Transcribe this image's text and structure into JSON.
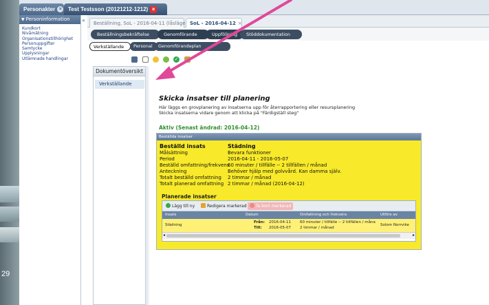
{
  "header": {
    "tabs": [
      {
        "label": "Personakter"
      },
      {
        "label": "Test Testsson (20121212-1212)"
      }
    ]
  },
  "left_strip": {
    "number": "29"
  },
  "sidebar": {
    "title": "Personinformation",
    "items": [
      {
        "label": "Kundkort"
      },
      {
        "label": "Nivåmätning"
      },
      {
        "label": "Organisationstillhörighet"
      },
      {
        "label": "Personuppgifter"
      },
      {
        "label": "Samtycke"
      },
      {
        "label": "Upplysningar"
      },
      {
        "label": "Utlämnade handlingar"
      }
    ]
  },
  "doc_tabs": [
    {
      "label": "Beställning, SoL - 2016-04-11 (låsläge)"
    },
    {
      "label": "SoL - 2016-04-12"
    }
  ],
  "workflow": [
    {
      "label": "Beställningsbekräftelse"
    },
    {
      "label": "Genomförande"
    },
    {
      "label": "Uppföljning"
    },
    {
      "label": "Stöddokumentation"
    }
  ],
  "subtabs": [
    {
      "label": "Verkställande"
    },
    {
      "label": "Personal"
    },
    {
      "label": "Genomförandeplan"
    }
  ],
  "toolbar": {
    "icons": [
      "clip-icon",
      "document-icon",
      "star-icon",
      "refresh-icon",
      "check-icon",
      "export-icon"
    ]
  },
  "doc_overview": {
    "title": "Dokumentöversikt",
    "item": "Verkställande"
  },
  "main": {
    "title": "Skicka insatser till planering",
    "desc1": "Här läggs en grovplanering av insatserna upp för återrapportering eller resursplanering",
    "desc2": "Skicka insatserna vidare genom att klicka på \"Färdigställ steg\"",
    "status": "Aktiv (Senast ändrad: 2016-04-12)"
  },
  "card": {
    "header": "Beställda insatser",
    "rows": [
      {
        "key": "Beställd insats",
        "value": "Städning"
      },
      {
        "key": "Målsättning",
        "value": "Bevara funktioner"
      },
      {
        "key": "Period",
        "value": "2016-04-11 - 2016-05-07"
      },
      {
        "key": "Beställd omfattning/frekvens",
        "value": "60 minuter / tillfälle -- 2 tillfällen / månad"
      },
      {
        "key": "Anteckning",
        "value": "Behöver hjälp med golvvård. Kan damma själv."
      },
      {
        "key": "Totalt beställd omfattning",
        "value": "2 timmar / månad"
      },
      {
        "key": "Totalt planerad omfattning",
        "value": "2 timmar / månad (2016-04-12)"
      }
    ],
    "planned_title": "Planerade insatser",
    "grid": {
      "buttons": [
        {
          "label": "Lägg till ny"
        },
        {
          "label": "Redigera markerad"
        },
        {
          "label": "Ta bort markerad"
        }
      ],
      "columns": [
        "Insats",
        "Datum",
        "Omfattning och frekvens",
        "Utförs av"
      ],
      "row": {
        "insats": "Städning",
        "from_label": "Från:",
        "from": "2016-04-11",
        "to_label": "Till:",
        "to": "2016-05-07",
        "omfattning1": "60 minuter / tillfälle -- 2 tillfällen / måna",
        "omfattning2": "2 timmar / månad",
        "utfors": "Solom Norrvike"
      }
    }
  },
  "colors": {
    "card_yellow": "#f8ea2a",
    "row_yellow": "#fff176",
    "accent_blue": "#4d6a8c",
    "status_green": "#2f8f2f",
    "arrow_pink": "#e0489a"
  }
}
